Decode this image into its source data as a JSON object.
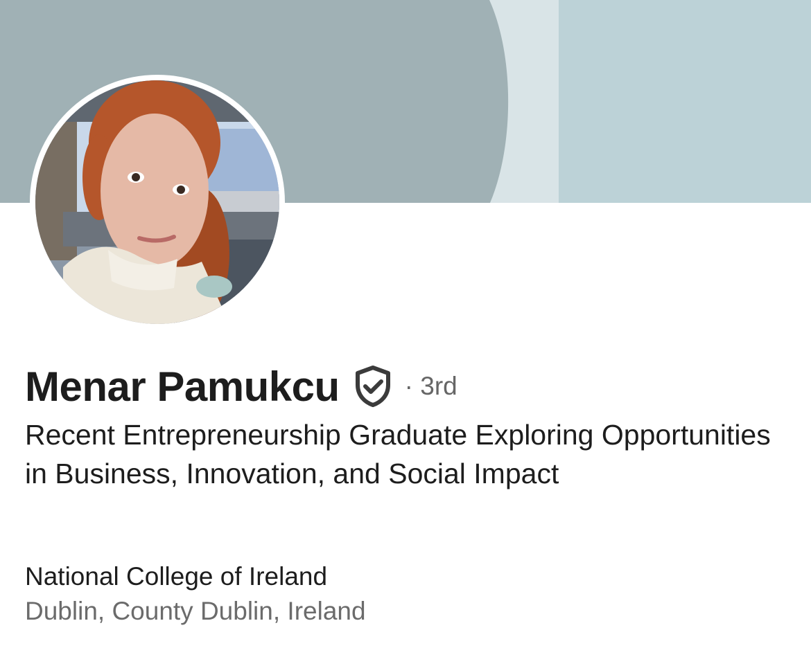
{
  "profile": {
    "name": "Menar Pamukcu",
    "degree": "· 3rd",
    "headline": "Recent Entrepreneurship Graduate Exploring Opportunities in Business, Innovation, and Social Impact",
    "school": "National College of Ireland",
    "location": "Dublin, County Dublin, Ireland",
    "verified_icon": "shield-check-icon"
  },
  "colors": {
    "banner_dark": "#a0b1b5",
    "banner_mid": "#d9e4e7",
    "banner_light": "#bcd2d7",
    "text_primary": "#1d1d1d",
    "text_secondary": "#6b6b6b"
  }
}
